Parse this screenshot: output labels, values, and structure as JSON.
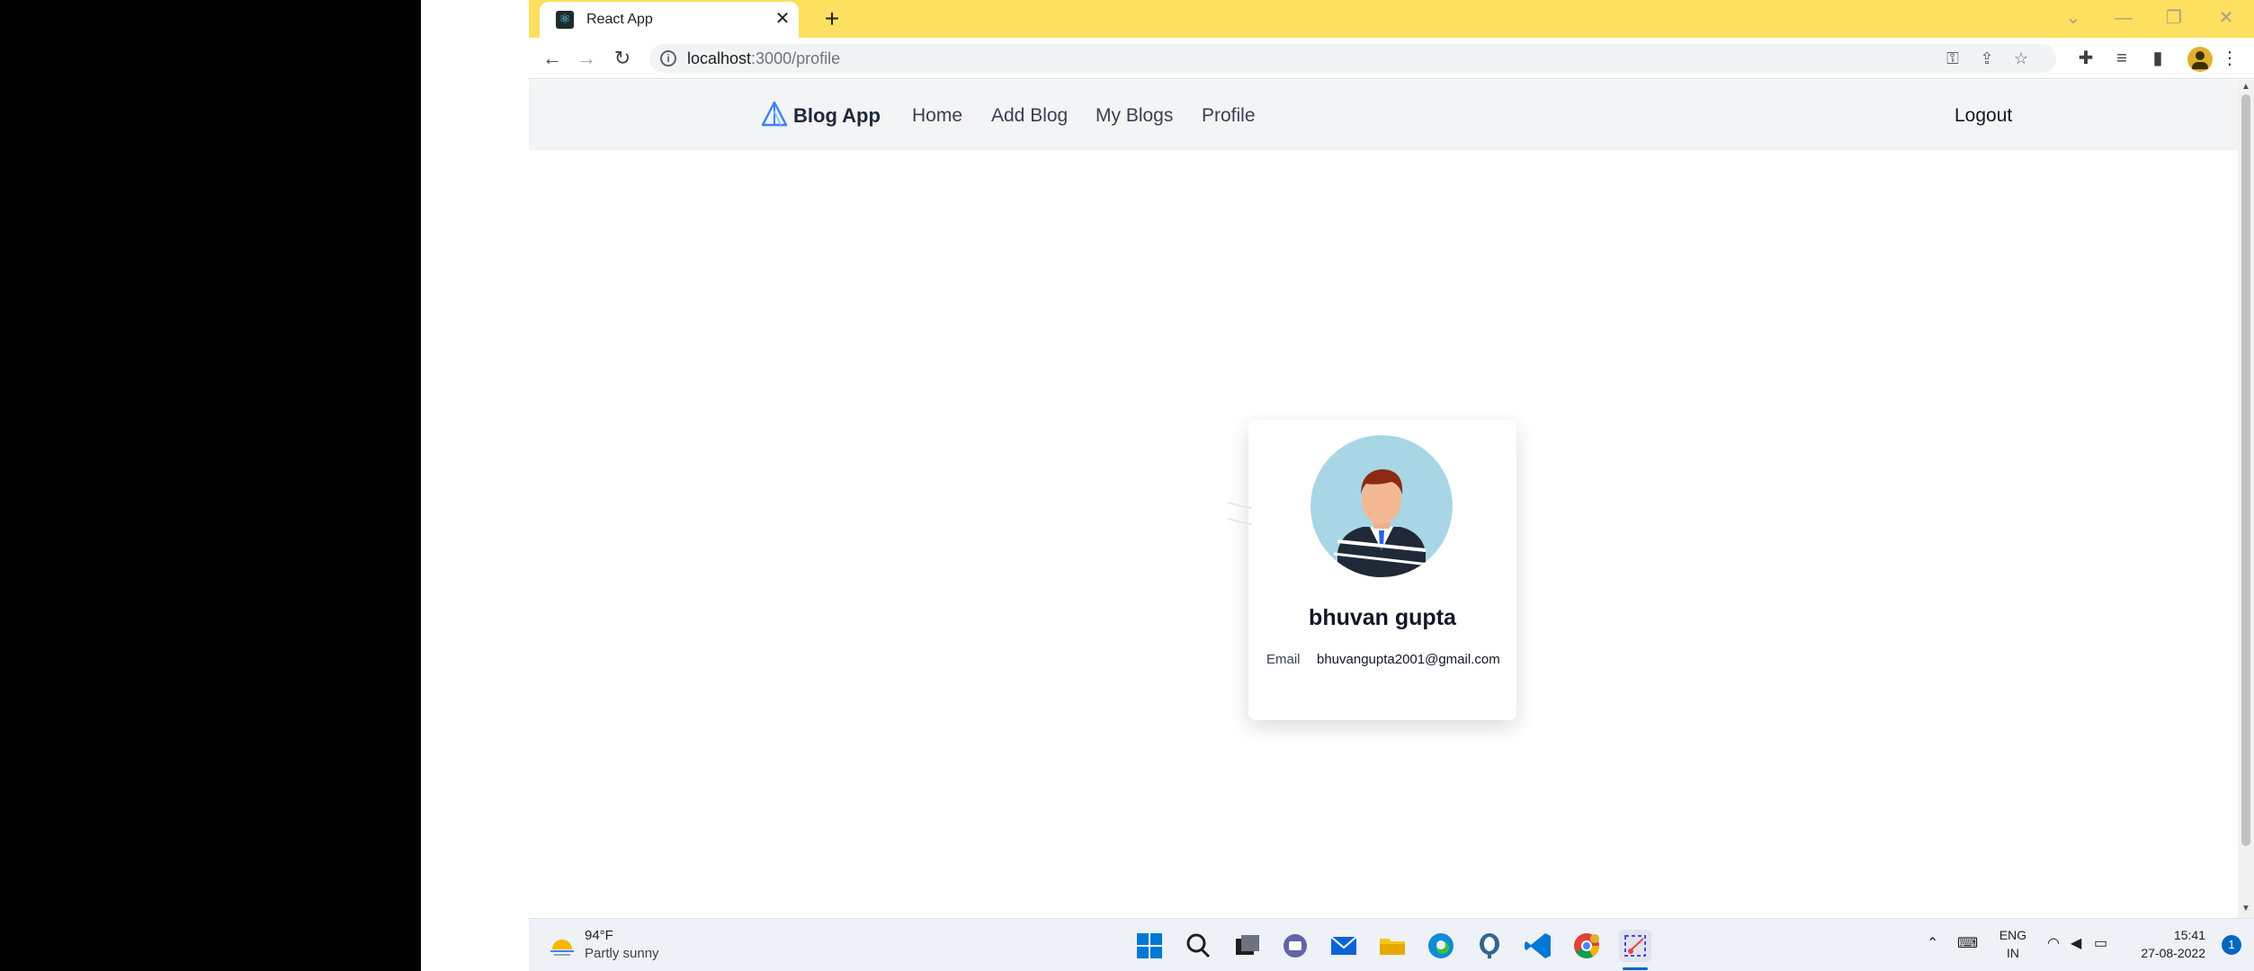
{
  "browser": {
    "tab_title": "React App",
    "tab_close": "✕",
    "new_tab": "+",
    "url_host": "localhost",
    "url_path": ":3000/profile",
    "controls": {
      "minimize": "—",
      "restore": "❐",
      "close": "✕",
      "dropdown": "⌄"
    }
  },
  "navbar": {
    "brand": "Blog App",
    "links": [
      "Home",
      "Add Blog",
      "My Blogs",
      "Profile"
    ],
    "logout": "Logout"
  },
  "profile": {
    "name": "bhuvan gupta",
    "email_label": "Email",
    "email": "bhuvangupta2001@gmail.com"
  },
  "taskbar": {
    "weather_temp": "94°F",
    "weather_desc": "Partly sunny",
    "lang_line1": "ENG",
    "lang_line2": "IN",
    "time": "15:41",
    "date": "27-08-2022",
    "notification_count": "1",
    "apps": [
      "start-icon",
      "search-icon",
      "task-view-icon",
      "chat-icon",
      "mail-icon",
      "file-explorer-icon",
      "edge-icon",
      "pgadmin-icon",
      "vscode-icon",
      "chrome-icon",
      "snipping-tool-icon"
    ]
  },
  "colors": {
    "tabstrip": "#fde05f",
    "navbar_bg": "#f3f4f6",
    "accent_blue": "#3b82f6",
    "avatar_bg": "#a9d6e5"
  }
}
